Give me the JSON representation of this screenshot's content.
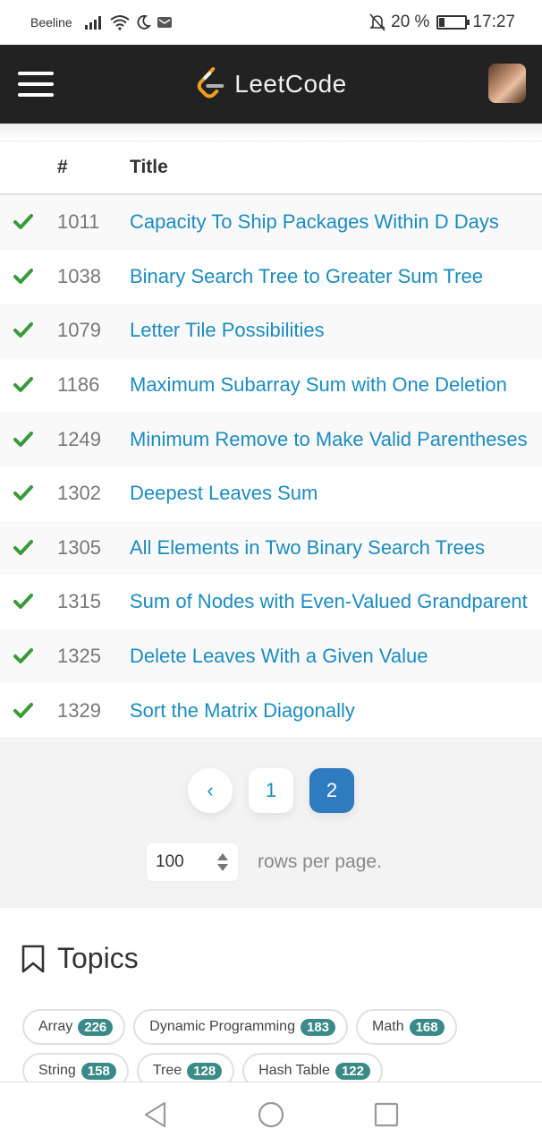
{
  "status_bar": {
    "carrier": "Beeline",
    "battery": "20 %",
    "time": "17:27"
  },
  "header": {
    "brand": "LeetCode"
  },
  "table": {
    "columns": [
      "#",
      "Title"
    ],
    "rows": [
      {
        "num": "1011",
        "title": "Capacity To Ship Packages Within D Days"
      },
      {
        "num": "1038",
        "title": "Binary Search Tree to Greater Sum Tree"
      },
      {
        "num": "1079",
        "title": "Letter Tile Possibilities"
      },
      {
        "num": "1186",
        "title": "Maximum Subarray Sum with One Deletion"
      },
      {
        "num": "1249",
        "title": "Minimum Remove to Make Valid Parentheses"
      },
      {
        "num": "1302",
        "title": "Deepest Leaves Sum"
      },
      {
        "num": "1305",
        "title": "All Elements in Two Binary Search Trees"
      },
      {
        "num": "1315",
        "title": "Sum of Nodes with Even-Valued Grandparent"
      },
      {
        "num": "1325",
        "title": "Delete Leaves With a Given Value"
      },
      {
        "num": "1329",
        "title": "Sort the Matrix Diagonally"
      }
    ]
  },
  "pagination": {
    "prev": "‹",
    "pages": [
      "1",
      "2"
    ],
    "active_page": "2",
    "rows_value": "100",
    "rows_label": "rows per page."
  },
  "topics": {
    "title": "Topics",
    "tags": [
      {
        "name": "Array",
        "count": "226"
      },
      {
        "name": "Dynamic Programming",
        "count": "183"
      },
      {
        "name": "Math",
        "count": "168"
      },
      {
        "name": "String",
        "count": "158"
      },
      {
        "name": "Tree",
        "count": "128"
      },
      {
        "name": "Hash Table",
        "count": "122"
      }
    ]
  },
  "colors": {
    "header_bg": "#222222",
    "link": "#1a8cc0",
    "check": "#3a9a3a",
    "active_page": "#2e7bbf",
    "tag_count": "#3a8a88"
  }
}
